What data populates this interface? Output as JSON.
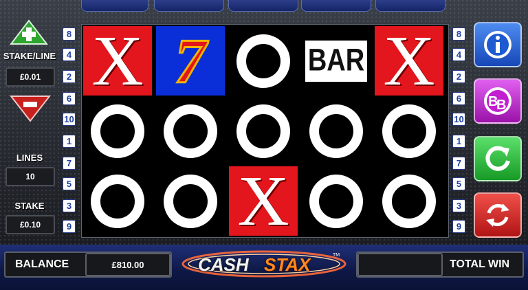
{
  "left_panel": {
    "stake_line_label": "STAKE/LINE",
    "stake_line_value": "£0.01",
    "lines_label": "LINES",
    "lines_value": "10",
    "stake_label": "STAKE",
    "stake_value": "£0.10"
  },
  "paylines_left": [
    "8",
    "4",
    "2",
    "6",
    "10",
    "1",
    "7",
    "5",
    "3",
    "9"
  ],
  "paylines_right": [
    "8",
    "4",
    "2",
    "6",
    "10",
    "1",
    "7",
    "5",
    "3",
    "9"
  ],
  "reels": [
    [
      "X",
      "O",
      "O"
    ],
    [
      "7",
      "O",
      "O"
    ],
    [
      "O",
      "O",
      "X"
    ],
    [
      "BAR",
      "O",
      "O"
    ],
    [
      "X",
      "O",
      "O"
    ]
  ],
  "bottom": {
    "balance_label": "BALANCE",
    "balance_value": "£810.00",
    "logo_cash": "CASH",
    "logo_stax": "STAX",
    "logo_tm": "TM",
    "win_value": "",
    "total_win_label": "TOTAL WIN"
  },
  "colors": {
    "info": "#1e63d6",
    "bb": "#c21fd0",
    "spin": "#25b532",
    "autoplay": "#d61f1f"
  },
  "icons": {
    "plus": "plus-icon",
    "minus": "minus-icon",
    "info": "info-icon",
    "bb": "big-bet-icon",
    "spin": "spin-icon",
    "autoplay": "autoplay-icon"
  }
}
